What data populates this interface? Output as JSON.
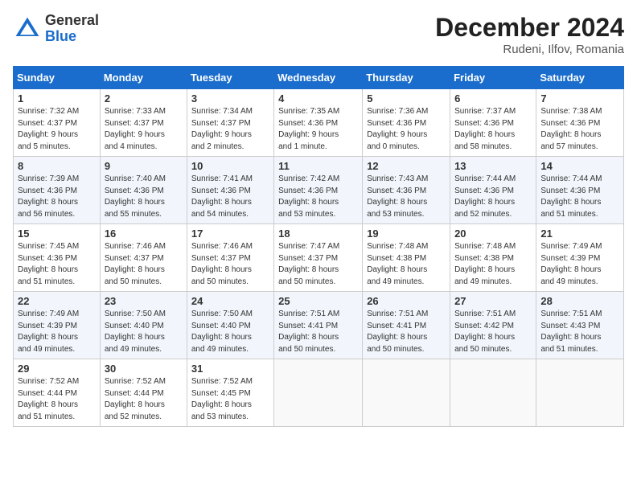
{
  "header": {
    "logo_general": "General",
    "logo_blue": "Blue",
    "month_title": "December 2024",
    "location": "Rudeni, Ilfov, Romania"
  },
  "days_of_week": [
    "Sunday",
    "Monday",
    "Tuesday",
    "Wednesday",
    "Thursday",
    "Friday",
    "Saturday"
  ],
  "weeks": [
    [
      {
        "day": "1",
        "info": "Sunrise: 7:32 AM\nSunset: 4:37 PM\nDaylight: 9 hours\nand 5 minutes."
      },
      {
        "day": "2",
        "info": "Sunrise: 7:33 AM\nSunset: 4:37 PM\nDaylight: 9 hours\nand 4 minutes."
      },
      {
        "day": "3",
        "info": "Sunrise: 7:34 AM\nSunset: 4:37 PM\nDaylight: 9 hours\nand 2 minutes."
      },
      {
        "day": "4",
        "info": "Sunrise: 7:35 AM\nSunset: 4:36 PM\nDaylight: 9 hours\nand 1 minute."
      },
      {
        "day": "5",
        "info": "Sunrise: 7:36 AM\nSunset: 4:36 PM\nDaylight: 9 hours\nand 0 minutes."
      },
      {
        "day": "6",
        "info": "Sunrise: 7:37 AM\nSunset: 4:36 PM\nDaylight: 8 hours\nand 58 minutes."
      },
      {
        "day": "7",
        "info": "Sunrise: 7:38 AM\nSunset: 4:36 PM\nDaylight: 8 hours\nand 57 minutes."
      }
    ],
    [
      {
        "day": "8",
        "info": "Sunrise: 7:39 AM\nSunset: 4:36 PM\nDaylight: 8 hours\nand 56 minutes."
      },
      {
        "day": "9",
        "info": "Sunrise: 7:40 AM\nSunset: 4:36 PM\nDaylight: 8 hours\nand 55 minutes."
      },
      {
        "day": "10",
        "info": "Sunrise: 7:41 AM\nSunset: 4:36 PM\nDaylight: 8 hours\nand 54 minutes."
      },
      {
        "day": "11",
        "info": "Sunrise: 7:42 AM\nSunset: 4:36 PM\nDaylight: 8 hours\nand 53 minutes."
      },
      {
        "day": "12",
        "info": "Sunrise: 7:43 AM\nSunset: 4:36 PM\nDaylight: 8 hours\nand 53 minutes."
      },
      {
        "day": "13",
        "info": "Sunrise: 7:44 AM\nSunset: 4:36 PM\nDaylight: 8 hours\nand 52 minutes."
      },
      {
        "day": "14",
        "info": "Sunrise: 7:44 AM\nSunset: 4:36 PM\nDaylight: 8 hours\nand 51 minutes."
      }
    ],
    [
      {
        "day": "15",
        "info": "Sunrise: 7:45 AM\nSunset: 4:36 PM\nDaylight: 8 hours\nand 51 minutes."
      },
      {
        "day": "16",
        "info": "Sunrise: 7:46 AM\nSunset: 4:37 PM\nDaylight: 8 hours\nand 50 minutes."
      },
      {
        "day": "17",
        "info": "Sunrise: 7:46 AM\nSunset: 4:37 PM\nDaylight: 8 hours\nand 50 minutes."
      },
      {
        "day": "18",
        "info": "Sunrise: 7:47 AM\nSunset: 4:37 PM\nDaylight: 8 hours\nand 50 minutes."
      },
      {
        "day": "19",
        "info": "Sunrise: 7:48 AM\nSunset: 4:38 PM\nDaylight: 8 hours\nand 49 minutes."
      },
      {
        "day": "20",
        "info": "Sunrise: 7:48 AM\nSunset: 4:38 PM\nDaylight: 8 hours\nand 49 minutes."
      },
      {
        "day": "21",
        "info": "Sunrise: 7:49 AM\nSunset: 4:39 PM\nDaylight: 8 hours\nand 49 minutes."
      }
    ],
    [
      {
        "day": "22",
        "info": "Sunrise: 7:49 AM\nSunset: 4:39 PM\nDaylight: 8 hours\nand 49 minutes."
      },
      {
        "day": "23",
        "info": "Sunrise: 7:50 AM\nSunset: 4:40 PM\nDaylight: 8 hours\nand 49 minutes."
      },
      {
        "day": "24",
        "info": "Sunrise: 7:50 AM\nSunset: 4:40 PM\nDaylight: 8 hours\nand 49 minutes."
      },
      {
        "day": "25",
        "info": "Sunrise: 7:51 AM\nSunset: 4:41 PM\nDaylight: 8 hours\nand 50 minutes."
      },
      {
        "day": "26",
        "info": "Sunrise: 7:51 AM\nSunset: 4:41 PM\nDaylight: 8 hours\nand 50 minutes."
      },
      {
        "day": "27",
        "info": "Sunrise: 7:51 AM\nSunset: 4:42 PM\nDaylight: 8 hours\nand 50 minutes."
      },
      {
        "day": "28",
        "info": "Sunrise: 7:51 AM\nSunset: 4:43 PM\nDaylight: 8 hours\nand 51 minutes."
      }
    ],
    [
      {
        "day": "29",
        "info": "Sunrise: 7:52 AM\nSunset: 4:44 PM\nDaylight: 8 hours\nand 51 minutes."
      },
      {
        "day": "30",
        "info": "Sunrise: 7:52 AM\nSunset: 4:44 PM\nDaylight: 8 hours\nand 52 minutes."
      },
      {
        "day": "31",
        "info": "Sunrise: 7:52 AM\nSunset: 4:45 PM\nDaylight: 8 hours\nand 53 minutes."
      },
      {
        "day": "",
        "info": ""
      },
      {
        "day": "",
        "info": ""
      },
      {
        "day": "",
        "info": ""
      },
      {
        "day": "",
        "info": ""
      }
    ]
  ]
}
